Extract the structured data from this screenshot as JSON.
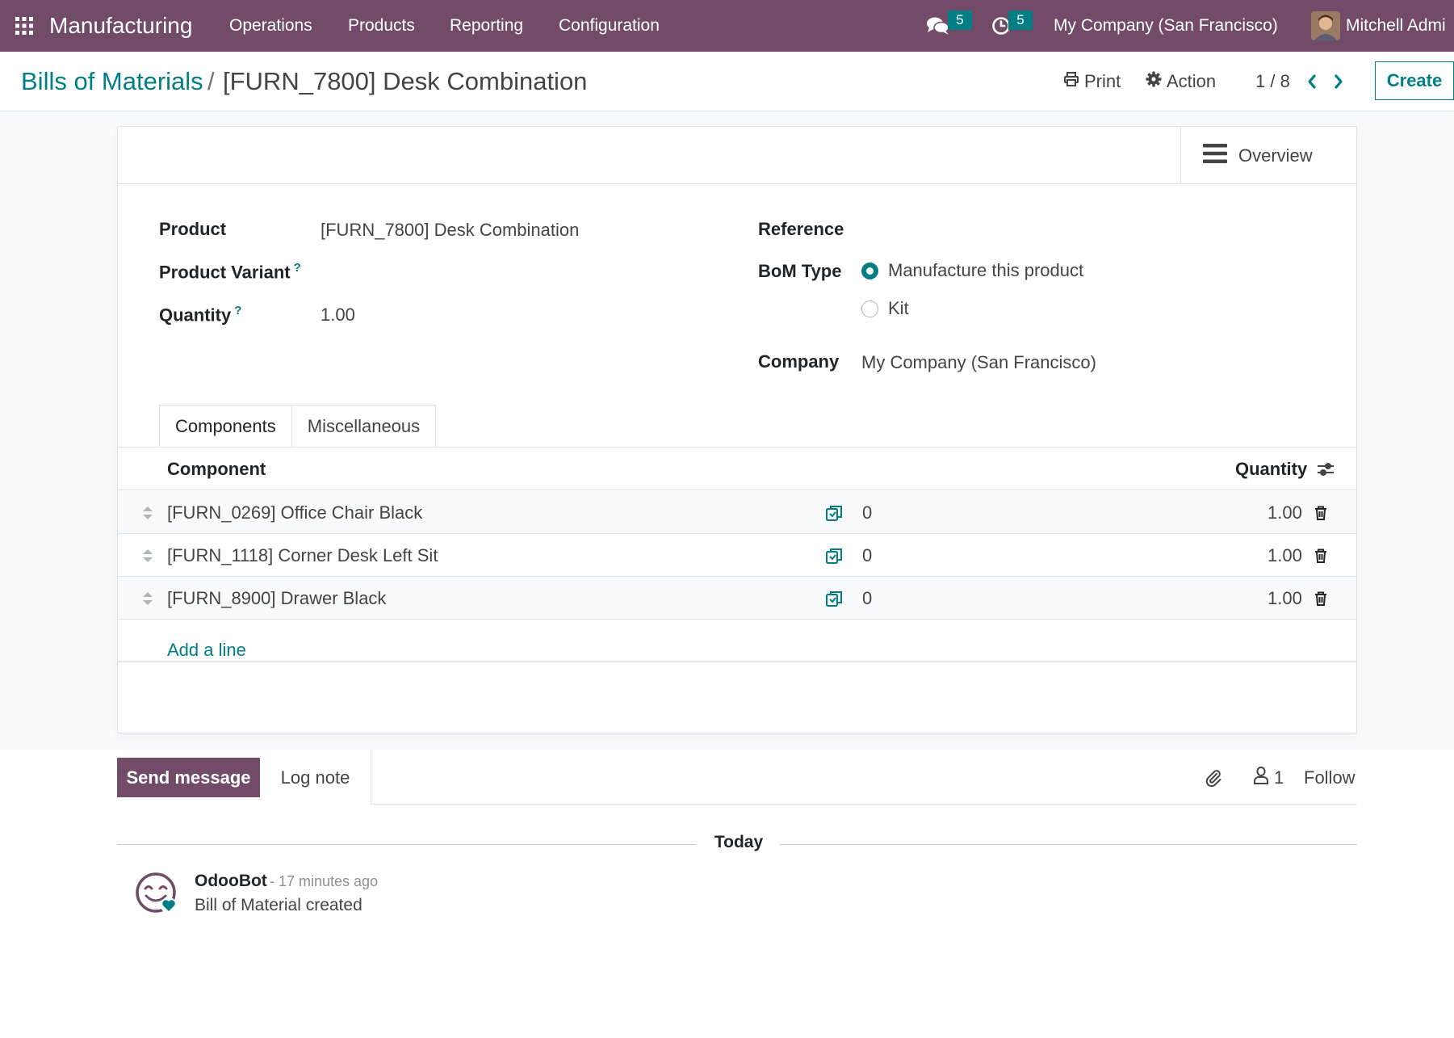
{
  "navbar": {
    "app_name": "Manufacturing",
    "menus": [
      "Operations",
      "Products",
      "Reporting",
      "Configuration"
    ],
    "messages_count": "5",
    "activities_count": "5",
    "company": "My Company (San Francisco)",
    "user": "Mitchell Admi"
  },
  "control_panel": {
    "breadcrumb_parent": "Bills of Materials",
    "breadcrumb_separator": "/",
    "breadcrumb_current": "[FURN_7800] Desk Combination",
    "print_label": "Print",
    "action_label": "Action",
    "pager": "1 / 8",
    "create_label": "Create"
  },
  "button_box": {
    "overview_label": "Overview"
  },
  "form": {
    "product_label": "Product",
    "product_value": "[FURN_7800] Desk Combination",
    "variant_label": "Product Variant",
    "variant_help": "?",
    "quantity_label": "Quantity",
    "quantity_help": "?",
    "quantity_value": "1.00",
    "reference_label": "Reference",
    "reference_value": "",
    "bom_type_label": "BoM Type",
    "bom_type_options": [
      {
        "label": "Manufacture this product",
        "checked": true
      },
      {
        "label": "Kit",
        "checked": false
      }
    ],
    "company_label": "Company",
    "company_value": "My Company (San Francisco)"
  },
  "tabs": [
    "Components",
    "Miscellaneous"
  ],
  "components_table": {
    "headers": {
      "component": "Component",
      "quantity": "Quantity"
    },
    "rows": [
      {
        "component": "[FURN_0269] Office Chair Black",
        "forecast": "0",
        "quantity": "1.00"
      },
      {
        "component": "[FURN_1118] Corner Desk Left Sit",
        "forecast": "0",
        "quantity": "1.00"
      },
      {
        "component": "[FURN_8900] Drawer Black",
        "forecast": "0",
        "quantity": "1.00"
      }
    ],
    "add_line_label": "Add a line"
  },
  "chatter": {
    "send_message_label": "Send message",
    "log_note_label": "Log note",
    "followers_count": "1",
    "follow_label": "Follow",
    "date_separator": "Today",
    "messages": [
      {
        "author": "OdooBot",
        "time": "- 17 minutes ago",
        "body": "Bill of Material created"
      }
    ]
  },
  "colors": {
    "brand_purple": "#714B67",
    "accent_teal": "#017E84"
  }
}
